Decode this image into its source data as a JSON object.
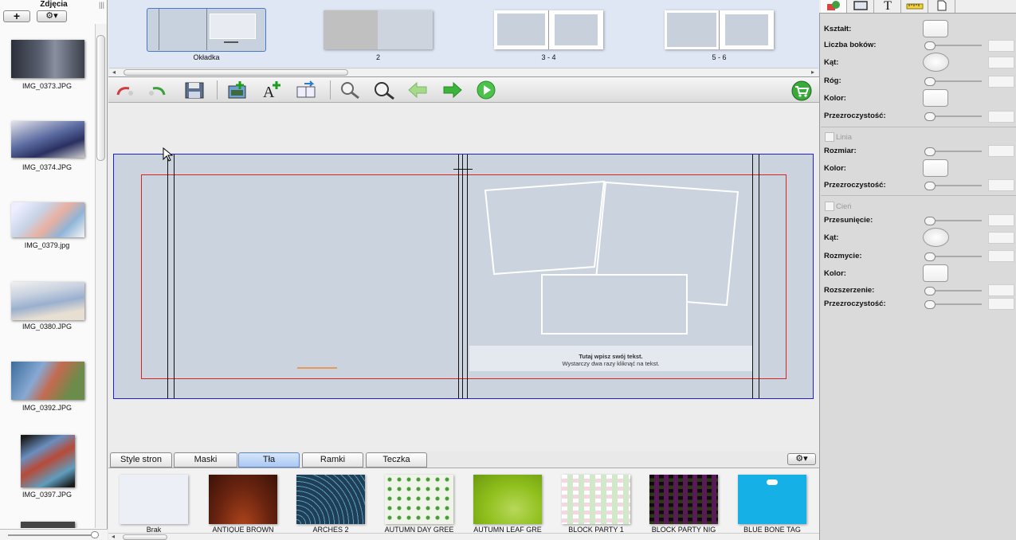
{
  "left_panel": {
    "title": "Zdjęcia",
    "add_label": "+",
    "gear_label": "⚙▾",
    "photos": [
      {
        "name": "IMG_0373.JPG"
      },
      {
        "name": "IMG_0374.JPG"
      },
      {
        "name": "IMG_0379.jpg"
      },
      {
        "name": "IMG_0380.JPG"
      },
      {
        "name": "IMG_0392.JPG"
      },
      {
        "name": "IMG_0397.JPG"
      }
    ]
  },
  "page_strip": {
    "pages": [
      {
        "label": "Okładka",
        "selected": true
      },
      {
        "label": "2",
        "selected": false
      },
      {
        "label": "3 - 4",
        "selected": false
      },
      {
        "label": "5 - 6",
        "selected": false
      }
    ]
  },
  "toolbar": {
    "undo_icon": "undo-icon",
    "redo_icon": "redo-icon",
    "save_icon": "save-icon",
    "add_photo_icon": "add-photo-icon",
    "add_text_icon": "add-text-icon",
    "add_text_symbol": "A",
    "page_icon": "page-icon",
    "zoom_out_icon": "zoom-out-icon",
    "zoom_in_icon": "zoom-in-icon",
    "prev_icon": "arrow-left-icon",
    "next_icon": "arrow-right-icon",
    "play_icon": "play-icon",
    "cart_icon": "cart-icon"
  },
  "canvas": {
    "placeholder_line1": "Tutaj wpisz swój tekst.",
    "placeholder_line2": "Wystarczy dwa razy kliknąć na tekst."
  },
  "bottom_tabs": {
    "tabs": [
      "Style stron",
      "Maski",
      "Tła",
      "Ramki",
      "Teczka"
    ],
    "active": "Tła",
    "gear_label": "⚙▾"
  },
  "backgrounds": [
    {
      "name": "Brak",
      "color": "#ecf0f6"
    },
    {
      "name": "ANTIQUE BROWN",
      "color": "#6a2410"
    },
    {
      "name": "ARCHES 2",
      "color": "#1f3e5a"
    },
    {
      "name": "AUTUMN DAY GREE",
      "color": "#eef5e8"
    },
    {
      "name": "AUTUMN LEAF GRE",
      "color": "#8fbf1c"
    },
    {
      "name": "BLOCK PARTY 1",
      "color": "#ffffff"
    },
    {
      "name": "BLOCK PARTY NIG",
      "color": "#140814"
    },
    {
      "name": "BLUE BONE TAG",
      "color": "#15b1e6"
    }
  ],
  "properties": {
    "tabs": [
      "shape-tab-icon",
      "frame-tab-icon",
      "text-tab-icon",
      "ruler-tab-icon",
      "page-tab-icon"
    ],
    "text_tab_symbol": "T",
    "shape": {
      "ksztalt": "Kształt:",
      "liczba_bokow": "Liczba boków:",
      "kat": "Kąt:",
      "rog": "Róg:",
      "kolor": "Kolor:",
      "przezroczystosc": "Przezroczystość:"
    },
    "line": {
      "title": "Linia",
      "rozmiar": "Rozmiar:",
      "kolor": "Kolor:",
      "przezroczystosc": "Przezroczystość:"
    },
    "shadow": {
      "title": "Cień",
      "przesuniecie": "Przesunięcie:",
      "kat": "Kąt:",
      "rozmycie": "Rozmycie:",
      "kolor": "Kolor:",
      "rozszerzenie": "Rozszerzenie:",
      "przezroczystosc": "Przezroczystość:"
    }
  }
}
